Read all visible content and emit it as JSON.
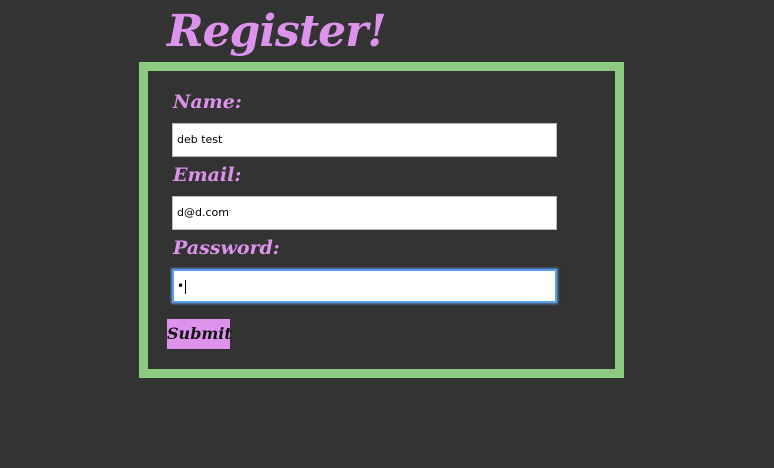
{
  "page": {
    "title": "Register!",
    "accent_color": "#dd93ec",
    "border_color": "#8ccb80",
    "background_color": "#333333"
  },
  "form": {
    "name_label": "Name:",
    "name_value": "deb test",
    "email_label": "Email:",
    "email_value": "d@d.com",
    "password_label": "Password:",
    "password_value": "•",
    "submit_label": "Submit"
  }
}
